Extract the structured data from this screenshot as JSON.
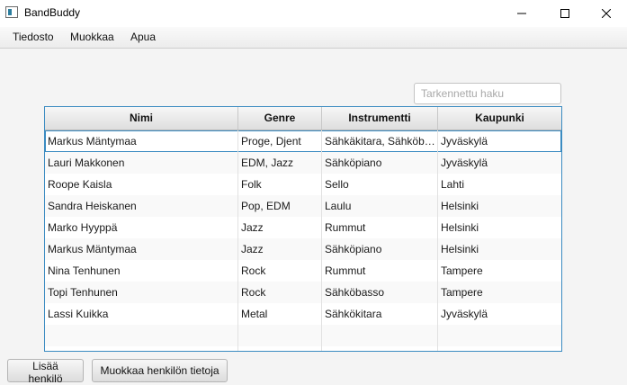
{
  "window": {
    "title": "BandBuddy"
  },
  "menu": {
    "items": [
      "Tiedosto",
      "Muokkaa",
      "Apua"
    ]
  },
  "search": {
    "placeholder": "Tarkennettu haku",
    "value": ""
  },
  "table": {
    "columns": [
      "Nimi",
      "Genre",
      "Instrumentti",
      "Kaupunki"
    ],
    "rows": [
      [
        "Markus Mäntymaa",
        "Proge, Djent",
        "Sähkäkitara, Sähköbasso",
        "Jyväskylä"
      ],
      [
        "Lauri Makkonen",
        "EDM, Jazz",
        "Sähköpiano",
        "Jyväskylä"
      ],
      [
        "Roope Kaisla",
        "Folk",
        "Sello",
        "Lahti"
      ],
      [
        "Sandra Heiskanen",
        "Pop, EDM",
        "Laulu",
        "Helsinki"
      ],
      [
        "Marko Hyyppä",
        "Jazz",
        "Rummut",
        "Helsinki"
      ],
      [
        "Markus Mäntymaa",
        "Jazz",
        "Sähköpiano",
        "Helsinki"
      ],
      [
        "Nina Tenhunen",
        "Rock",
        "Rummut",
        "Tampere"
      ],
      [
        "Topi Tenhunen",
        "Rock",
        "Sähköbasso",
        "Tampere"
      ],
      [
        "Lassi Kuikka",
        "Metal",
        "Sähkökitara",
        "Jyväskylä"
      ]
    ],
    "focused_row": 0
  },
  "buttons": {
    "add": "Lisää henkilö",
    "edit": "Muokkaa henkilön tietoja"
  },
  "icons": {
    "app": "app-icon",
    "minimize": "minimize-icon",
    "maximize": "maximize-icon",
    "close": "close-icon"
  },
  "colors": {
    "accent": "#3a8bc1",
    "row_alt": "#f9f9f9"
  }
}
